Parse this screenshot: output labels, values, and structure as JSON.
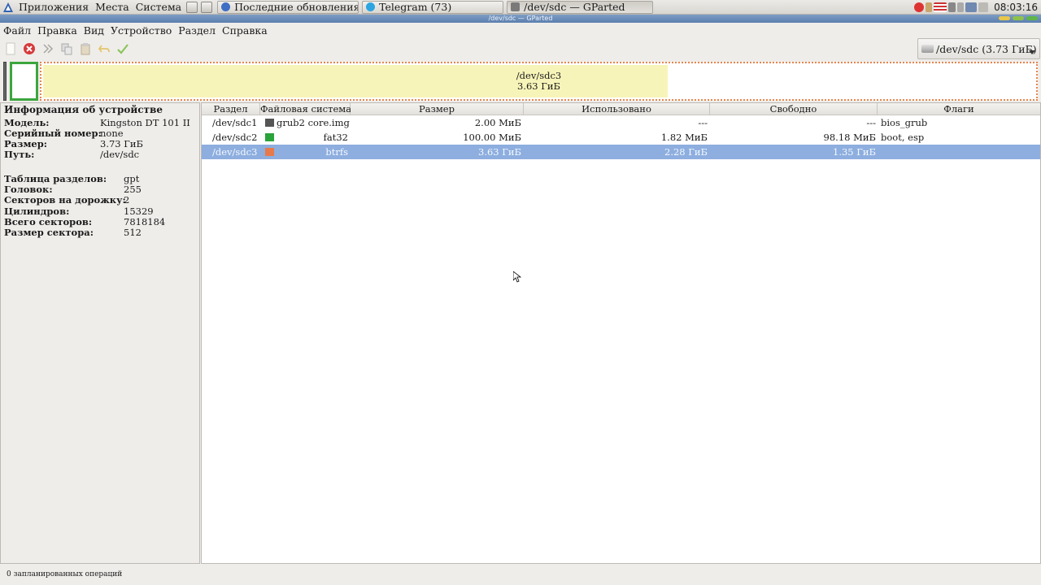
{
  "top_panel": {
    "menus": [
      "Приложения",
      "Места",
      "Система"
    ],
    "tasks": [
      {
        "label": "Последние обновления в ...",
        "icon": "chromium-icon",
        "color": "#3d6fc4"
      },
      {
        "label": "Telegram (73)",
        "icon": "telegram-icon",
        "color": "#2ca5e0"
      },
      {
        "label": "/dev/sdc — GParted",
        "icon": "gparted-icon",
        "color": "#7a7a7a"
      }
    ],
    "clock": "08:03:16"
  },
  "window_title": "/dev/sdc — GParted",
  "menubar": [
    "Файл",
    "Правка",
    "Вид",
    "Устройство",
    "Раздел",
    "Справка"
  ],
  "toolbar": {
    "icons": [
      "new-icon",
      "delete-icon",
      "resize-move-icon",
      "copy-icon",
      "paste-icon",
      "undo-icon",
      "apply-icon"
    ]
  },
  "device_selector": {
    "label": "/dev/sdc (3.73 ГиБ)"
  },
  "graph": {
    "partition_name": "/dev/sdc3",
    "partition_size": "3.63 ГиБ",
    "used_fraction": 0.63
  },
  "info": {
    "title": "Информация об устройстве",
    "rows1": [
      {
        "label": "Модель:",
        "value": "Kingston DT 101 II"
      },
      {
        "label": "Серийный номер:",
        "value": "none"
      },
      {
        "label": "Размер:",
        "value": "3.73 ГиБ"
      },
      {
        "label": "Путь:",
        "value": "/dev/sdc"
      }
    ],
    "rows2": [
      {
        "label": "Таблица разделов:",
        "value": "gpt"
      },
      {
        "label": "Головок:",
        "value": "255"
      },
      {
        "label": "Секторов на дорожку:",
        "value": "2"
      },
      {
        "label": "Цилиндров:",
        "value": "15329"
      },
      {
        "label": "Всего секторов:",
        "value": "7818184"
      },
      {
        "label": "Размер сектора:",
        "value": "512"
      }
    ]
  },
  "table": {
    "headers": [
      "Раздел",
      "Файловая система",
      "Размер",
      "Использовано",
      "Свободно",
      "Флаги"
    ],
    "rows": [
      {
        "partition": "/dev/sdc1",
        "fs": "grub2 core.img",
        "color": "#555555",
        "size": "2.00 МиБ",
        "used": "---",
        "free": "---",
        "flags": "bios_grub"
      },
      {
        "partition": "/dev/sdc2",
        "fs": "fat32",
        "color": "#2aa33a",
        "size": "100.00 МиБ",
        "used": "1.82 МиБ",
        "free": "98.18 МиБ",
        "flags": "boot, esp"
      },
      {
        "partition": "/dev/sdc3",
        "fs": "btrfs",
        "color": "#e8794a",
        "size": "3.63 ГиБ",
        "used": "2.28 ГиБ",
        "free": "1.35 ГиБ",
        "flags": ""
      }
    ]
  },
  "statusbar": "0 запланированных операций"
}
